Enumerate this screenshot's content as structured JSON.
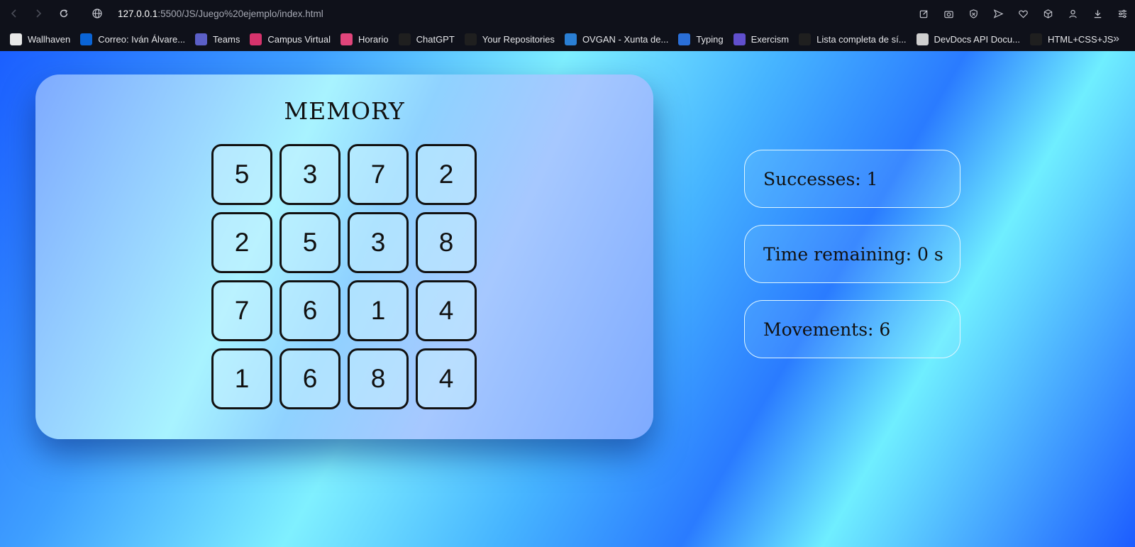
{
  "browser": {
    "url_host": "127.0.0.1",
    "url_path": ":5500/JS/Juego%20ejemplo/index.html",
    "bookmarks": [
      {
        "label": "Wallhaven",
        "icon": "wallhaven-icon",
        "color": "#e8e8e8"
      },
      {
        "label": "Correo: Iván Álvare...",
        "icon": "outlook-icon",
        "color": "#0a64d6"
      },
      {
        "label": "Teams",
        "icon": "teams-icon",
        "color": "#5b5fc7"
      },
      {
        "label": "Campus Virtual",
        "icon": "campus-icon",
        "color": "#d6336c"
      },
      {
        "label": "Horario",
        "icon": "horario-icon",
        "color": "#e0457b"
      },
      {
        "label": "ChatGPT",
        "icon": "chatgpt-icon",
        "color": "#1f1f1f"
      },
      {
        "label": "Your Repositories",
        "icon": "github-icon",
        "color": "#1f1f1f"
      },
      {
        "label": "OVGAN - Xunta de...",
        "icon": "ovgan-icon",
        "color": "#2a7fd4"
      },
      {
        "label": "Typing",
        "icon": "typing-icon",
        "color": "#2a6fd8"
      },
      {
        "label": "Exercism",
        "icon": "exercism-icon",
        "color": "#604fcd"
      },
      {
        "label": "Lista completa de sí...",
        "icon": "x-icon",
        "color": "#1f1f1f"
      },
      {
        "label": "DevDocs API Docu...",
        "icon": "devdocs-icon",
        "color": "#cfcfcf"
      },
      {
        "label": "HTML+CSS+JS",
        "icon": "m-icon",
        "color": "#1f1f1f"
      }
    ],
    "more_label": "»"
  },
  "game": {
    "title": "MEMORY",
    "tiles": [
      "5",
      "3",
      "7",
      "2",
      "2",
      "5",
      "3",
      "8",
      "7",
      "6",
      "1",
      "4",
      "1",
      "6",
      "8",
      "4"
    ]
  },
  "stats": {
    "successes": "Successes: 1",
    "time": "Time remaining: 0 s",
    "movements": "Movements: 6"
  }
}
